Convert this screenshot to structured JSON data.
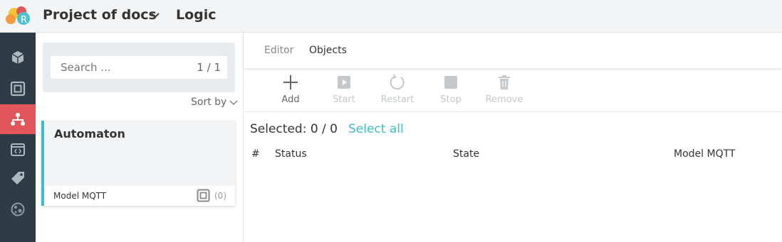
{
  "header": {
    "project_title": "Project of docs",
    "page_title": "Logic"
  },
  "rail": {
    "items": [
      {
        "icon": "cube-icon"
      },
      {
        "icon": "object-icon"
      },
      {
        "icon": "hierarchy-icon",
        "active": true
      },
      {
        "icon": "code-window-icon"
      },
      {
        "icon": "tag-icon"
      },
      {
        "icon": "globe-icon"
      }
    ]
  },
  "list": {
    "search_placeholder": "Search ...",
    "search_count": "1 / 1",
    "sort_label": "Sort by",
    "cards": [
      {
        "title": "Automaton",
        "type": "Model MQTT",
        "count": "(0)"
      }
    ]
  },
  "tabs": [
    {
      "label": "Editor"
    },
    {
      "label": "Objects",
      "active": true
    }
  ],
  "toolbar": {
    "add": "Add",
    "start": "Start",
    "restart": "Restart",
    "stop": "Stop",
    "remove": "Remove"
  },
  "selection": {
    "selected_text": "Selected: 0 / 0",
    "select_all": "Select all"
  },
  "table": {
    "columns": [
      "#",
      "Status",
      "State",
      "Model MQTT"
    ]
  },
  "colors": {
    "accent": "#3bbcc8",
    "rail_active": "#e0565b",
    "rail_bg": "#2f3b45"
  }
}
